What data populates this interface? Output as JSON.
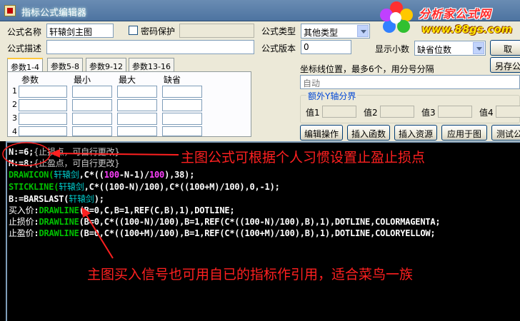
{
  "window": {
    "title": "指标公式编辑器"
  },
  "logo": {
    "name": "分析家公式网",
    "url": "www.88gs.com"
  },
  "form": {
    "name_label": "公式名称",
    "name_value": "轩辕剑主图",
    "password_label": "密码保护",
    "type_label": "公式类型",
    "type_value": "其他类型",
    "desc_label": "公式描述",
    "version_label": "公式版本",
    "version_value": "0",
    "decimals_label": "显示小数",
    "decimals_value": "缺省位数",
    "cancel_label": "取",
    "save_as_label": "另存公"
  },
  "tabs": [
    "参数1-4",
    "参数5-8",
    "参数9-12",
    "参数13-16"
  ],
  "params": {
    "headers": [
      "参数",
      "最小",
      "最大",
      "缺省"
    ],
    "rows": [
      "1",
      "2",
      "3",
      "4"
    ]
  },
  "axis": {
    "label": "坐标线位置，最多6个，用分号分隔",
    "placeholder": "自动",
    "extra_title": "额外Y轴分界",
    "value_labels": [
      "值1",
      "值2",
      "值3",
      "值4"
    ]
  },
  "buttons": [
    "编辑操作",
    "插入函数",
    "插入资源",
    "应用于图",
    "测试公"
  ],
  "code": {
    "line1": {
      "var": "N:=6;",
      "comment": "{止损点，可自行更改}"
    },
    "line2": {
      "var": "M:=8;",
      "comment": "{止盈点，可自行更改}"
    },
    "line3": {
      "fn": "DRAWICON(",
      "arg": "轩辕剑",
      "rest1": ",C*((",
      "num": "100",
      "rest2": "-N-1)/",
      "num2": "100",
      "rest3": "),38);"
    },
    "line4": {
      "fn": "STICKLINE(",
      "arg": "轩辕剑",
      "rest": ",C*((100-N)/100),C*((100+M)/100),0,-1);"
    },
    "line5": {
      "pre": "B:=BARSLAST(",
      "arg": "轩辕剑",
      "post": ");"
    },
    "line6": {
      "label": "买入价",
      "colon": ":",
      "fn": "DRAWLINE",
      "rest": "(B=0,C,B=1,REF(C,B),1),DOTLINE;"
    },
    "line7": {
      "label": "止损价",
      "colon": ":",
      "fn": "DRAWLINE",
      "rest": "(B=0,C*((100-N)/100),B=1,REF(C*((100-N)/100),B),1),DOTLINE,COLORMAGENTA;"
    },
    "line8": {
      "label": "止盈价",
      "colon": ":",
      "fn": "DRAWLINE",
      "rest": "(B=0,C*((100+M)/100),B=1,REF(C*((100+M)/100),B),1),DOTLINE,COLORYELLOW;"
    }
  },
  "annotations": {
    "top": "主图公式可根据个人习惯设置止盈止损点",
    "bottom": "主图买入信号也可用自已的指标作引用，适合菜鸟一族"
  }
}
